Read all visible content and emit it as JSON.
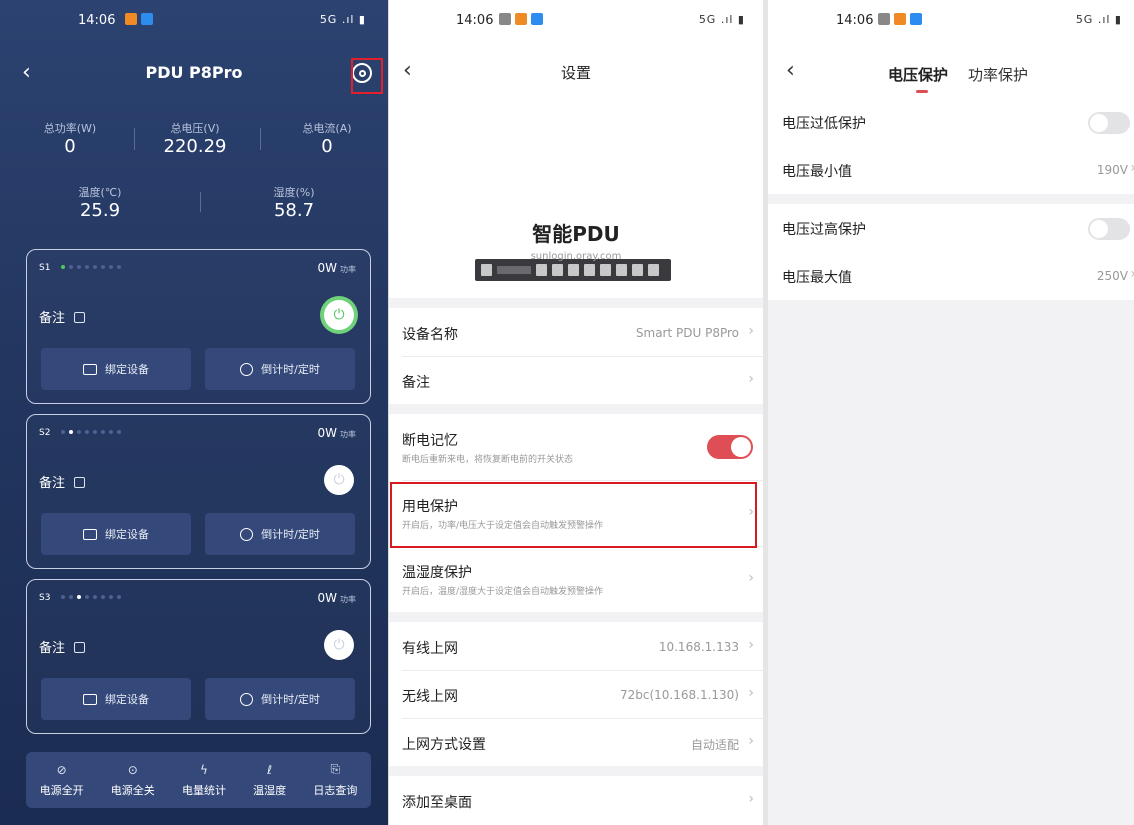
{
  "panel1": {
    "status": {
      "time": "14:06",
      "right": "5G .ıl ▮"
    },
    "title": "PDU P8Pro",
    "stats": [
      {
        "label": "总功率(W)",
        "value": "0"
      },
      {
        "label": "总电压(V)",
        "value": "220.29"
      },
      {
        "label": "总电流(A)",
        "value": "0"
      },
      {
        "label": "温度(℃)",
        "value": "25.9"
      },
      {
        "label": "湿度(%)",
        "value": "58.7"
      }
    ],
    "cards": [
      {
        "id": "S1",
        "power": "0W",
        "power_unit": "功率",
        "note": "备注",
        "on": true,
        "bind_label": "绑定设备",
        "timer_label": "倒计时/定时"
      },
      {
        "id": "S2",
        "power": "0W",
        "power_unit": "功率",
        "note": "备注",
        "on": false,
        "bind_label": "绑定设备",
        "timer_label": "倒计时/定时"
      },
      {
        "id": "S3",
        "power": "0W",
        "power_unit": "功率",
        "note": "备注",
        "on": false,
        "bind_label": "绑定设备",
        "timer_label": "倒计时/定时"
      }
    ],
    "nav": [
      {
        "label": "电源全开",
        "icon": "power-all-on-icon",
        "glyph": "⊘"
      },
      {
        "label": "电源全关",
        "icon": "power-all-off-icon",
        "glyph": "⊙"
      },
      {
        "label": "电量统计",
        "icon": "lightning-icon",
        "glyph": "ϟ"
      },
      {
        "label": "温湿度",
        "icon": "thermometer-icon",
        "glyph": "ℓ"
      },
      {
        "label": "日志查询",
        "icon": "log-search-icon",
        "glyph": "⎘"
      }
    ]
  },
  "panel2": {
    "status": {
      "time": "14:06",
      "right": "5G .ıl ▮"
    },
    "title": "设置",
    "device_name": "智能PDU",
    "device_url": "sunlogin.oray.com",
    "rows": {
      "name_label": "设备名称",
      "name_value": "Smart PDU P8Pro",
      "note_label": "备注",
      "mem_label": "断电记忆",
      "mem_sub": "断电后重新来电，将恢复断电前的开关状态",
      "prot_label": "用电保护",
      "prot_sub": "开启后，功率/电压大于设定值会自动触发预警操作",
      "temp_label": "温湿度保护",
      "temp_sub": "开启后，温度/湿度大于设定值会自动触发预警操作",
      "wired_label": "有线上网",
      "wired_value": "10.168.1.133",
      "wifi_label": "无线上网",
      "wifi_value": "72bc(10.168.1.130)",
      "mode_label": "上网方式设置",
      "mode_value": "自动适配",
      "desktop_label": "添加至桌面"
    }
  },
  "panel3": {
    "status": {
      "time": "14:06",
      "right": "5G .ıl ▮"
    },
    "tabs": [
      "电压保护",
      "功率保护"
    ],
    "rows": [
      {
        "label": "电压过低保护"
      },
      {
        "label": "电压最小值",
        "value": "190V"
      },
      {
        "label": "电压过高保护"
      },
      {
        "label": "电压最大值",
        "value": "250V"
      }
    ]
  }
}
